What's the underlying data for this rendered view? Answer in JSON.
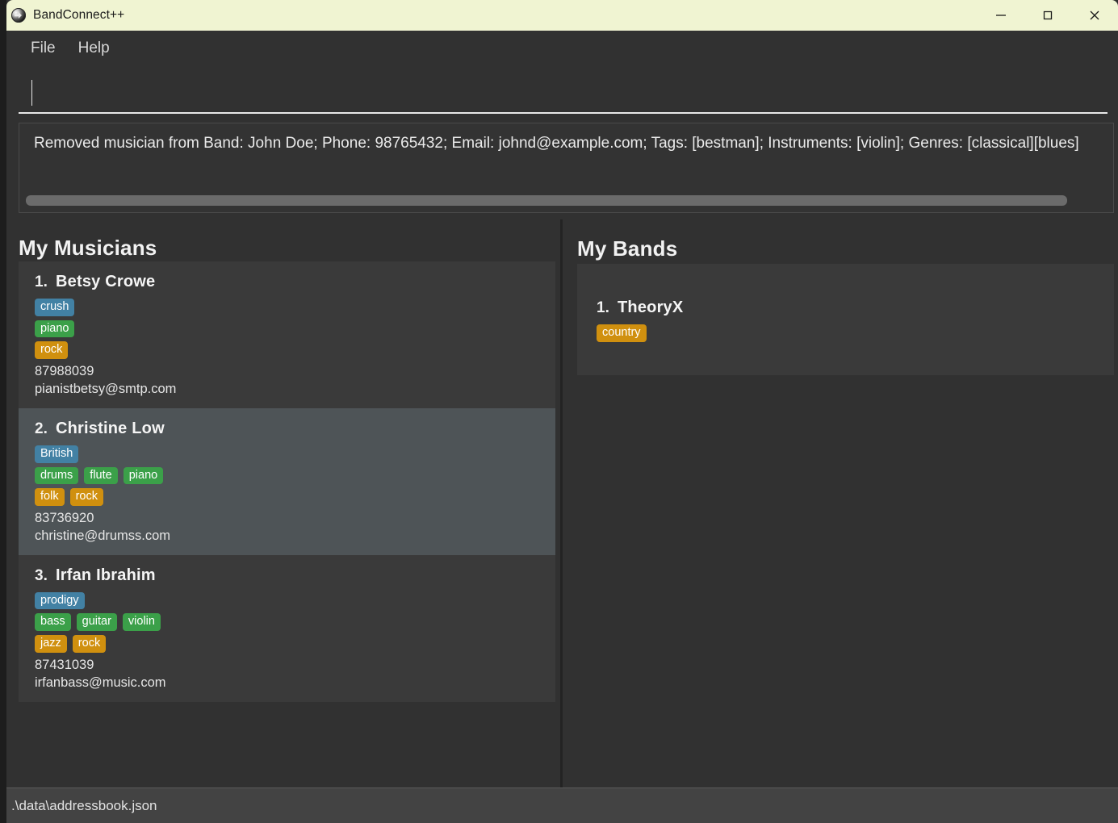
{
  "window": {
    "title": "BandConnect++",
    "icon": "app-globe-icon",
    "minimize_label": "—",
    "maximize_label": "□",
    "close_label": "✕",
    "titlebar_color": "#f0f4d2"
  },
  "menubar": {
    "items": [
      {
        "label": "File"
      },
      {
        "label": "Help"
      }
    ]
  },
  "command": {
    "value": "",
    "placeholder": ""
  },
  "result": {
    "text": "Removed musician from Band: John Doe; Phone: 98765432; Email: johnd@example.com; Tags: [bestman]; Instruments: [violin]; Genres: [classical][blues]"
  },
  "colors": {
    "tag": "#4281a4",
    "instrument": "#3ba049",
    "genre": "#d0900f",
    "selected_row": "#4e5457",
    "card": "#3a3a3a",
    "panel": "#313131"
  },
  "musicians_panel": {
    "title": "My Musicians",
    "entries": [
      {
        "index": "1.",
        "name": "Betsy Crowe",
        "tags": [
          "crush"
        ],
        "instruments": [
          "piano"
        ],
        "genres": [
          "rock"
        ],
        "phone": "87988039",
        "email": "pianistbetsy@smtp.com",
        "selected": false
      },
      {
        "index": "2.",
        "name": "Christine Low",
        "tags": [
          "British"
        ],
        "instruments": [
          "drums",
          "flute",
          "piano"
        ],
        "genres": [
          "folk",
          "rock"
        ],
        "phone": "83736920",
        "email": "christine@drumss.com",
        "selected": true
      },
      {
        "index": "3.",
        "name": "Irfan Ibrahim",
        "tags": [
          "prodigy"
        ],
        "instruments": [
          "bass",
          "guitar",
          "violin"
        ],
        "genres": [
          "jazz",
          "rock"
        ],
        "phone": "87431039",
        "email": "irfanbass@music.com",
        "selected": false
      }
    ]
  },
  "bands_panel": {
    "title": "My Bands",
    "entries": [
      {
        "index": "1.",
        "name": "TheoryX",
        "genres": [
          "country"
        ]
      }
    ]
  },
  "statusbar": {
    "path": ".\\data\\addressbook.json"
  }
}
